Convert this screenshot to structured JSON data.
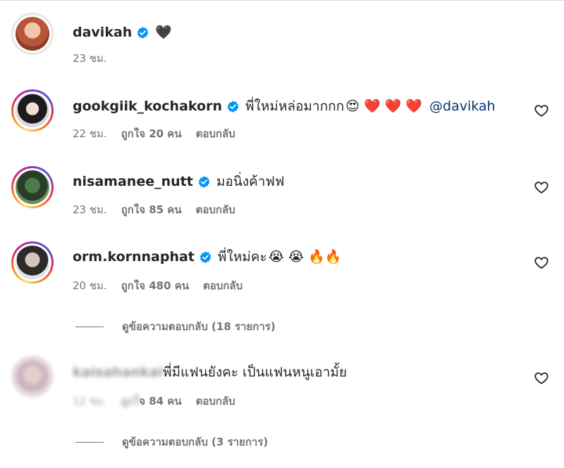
{
  "post": {
    "username": "davikah",
    "caption_emoji": "🖤",
    "time": "23 ชม."
  },
  "comments": [
    {
      "username": "gookgiik_kochakorn",
      "text": "พี่ใหม่หล่อมากกก",
      "emojis": "😍 ❤️ ❤️ ❤️",
      "mention": "@davikah",
      "time": "22 ชม.",
      "likes": "ถูกใจ 20 คน",
      "reply": "ตอบกลับ"
    },
    {
      "username": "nisamanee_nutt",
      "text": "มอนิ่งค้าฟฟ",
      "time": "23 ชม.",
      "likes": "ถูกใจ 85 คน",
      "reply": "ตอบกลับ"
    },
    {
      "username": "orm.kornnaphat",
      "text": "พี่ใหม่คะ",
      "emojis": "😭 😭 🔥🔥",
      "time": "20 ชม.",
      "likes": "ถูกใจ 480 คน",
      "reply": "ตอบกลับ",
      "view_replies": "ดูข้อความตอบกลับ (18 รายการ)"
    },
    {
      "username": "kaisahankai",
      "text": "พี่มีแฟนยังคะ เป็นแฟนหนูเอามั้ย",
      "time": "12 ชม.",
      "likes_prefix": "ถูกใ",
      "likes": "จ 84 คน",
      "reply": "ตอบกลับ",
      "view_replies": "ดูข้อความตอบกลับ (3 รายการ)"
    }
  ],
  "icons": {
    "verified": "verified-badge-icon",
    "like": "heart-outline-icon"
  },
  "colors": {
    "verified": "#0095f6",
    "mention": "#00376b",
    "secondary_text": "#737373"
  }
}
